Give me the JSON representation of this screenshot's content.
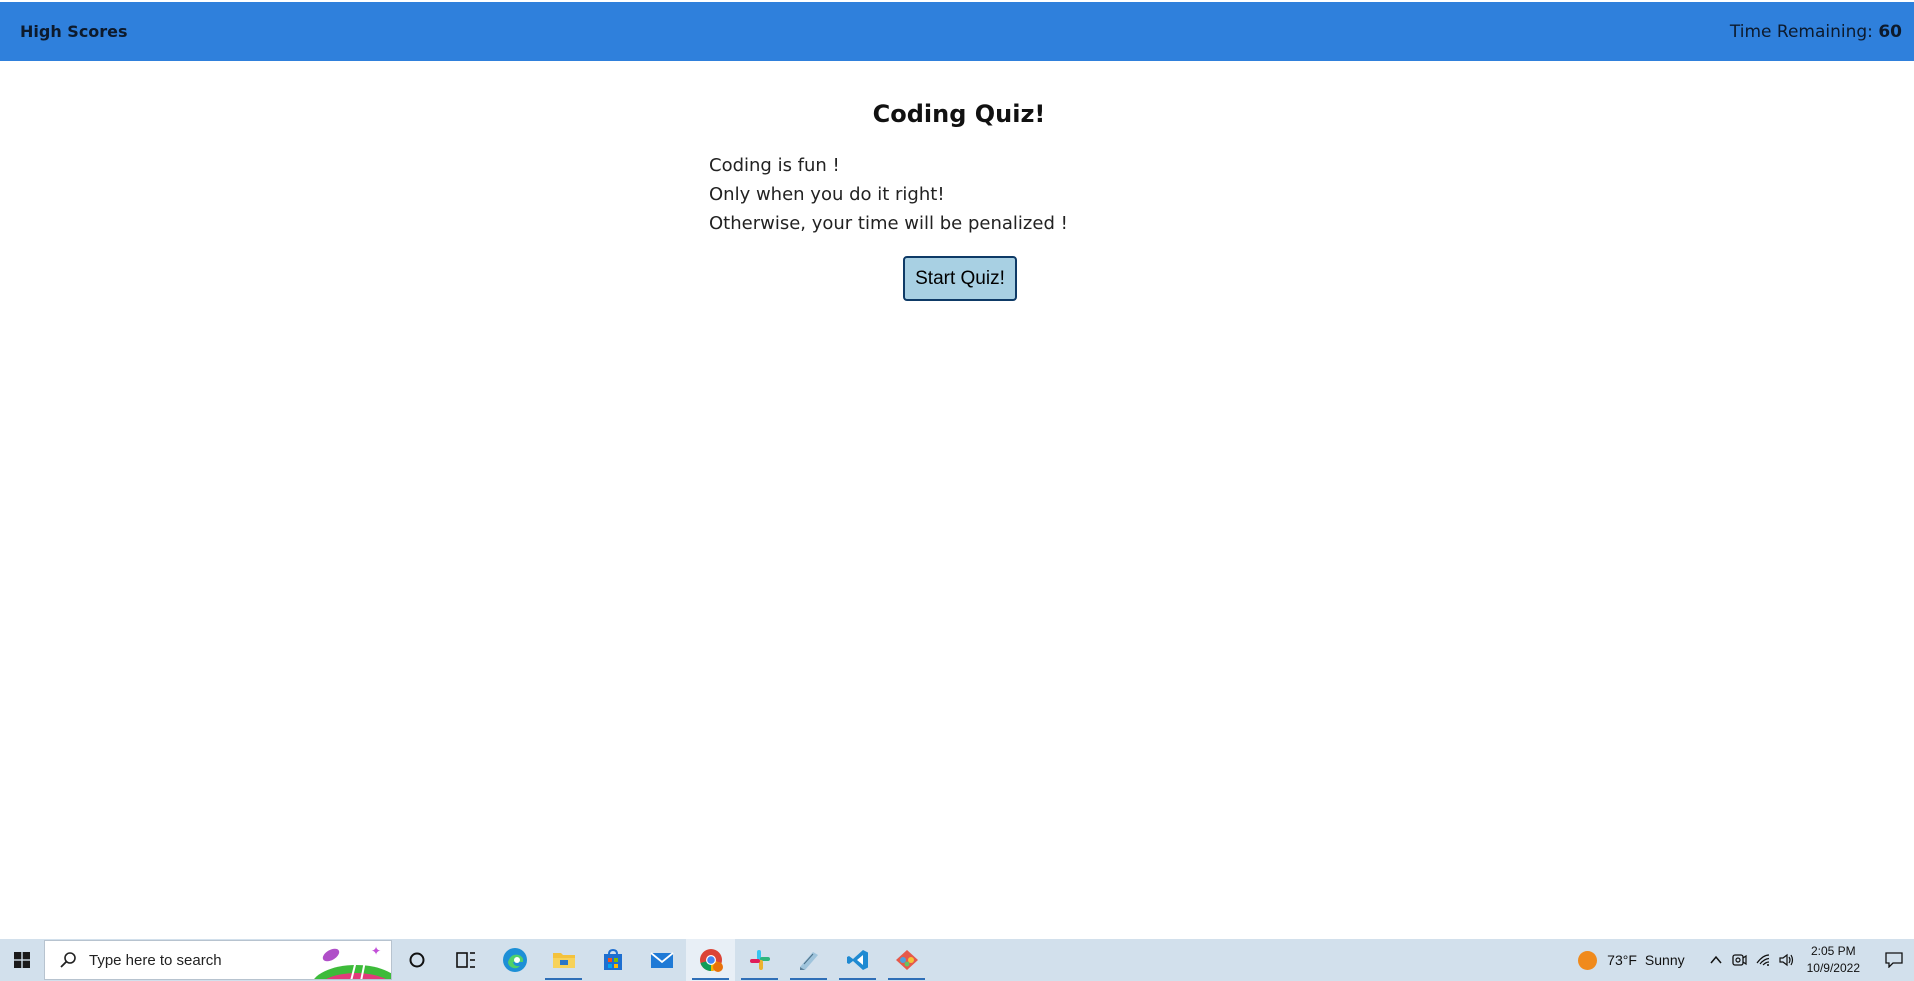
{
  "nav": {
    "high_scores": "High Scores",
    "time_label": "Time Remaining:",
    "time_value": "60"
  },
  "quiz": {
    "title": "Coding Quiz!",
    "lines": [
      "Coding is fun !",
      "Only when you do it right!",
      "Otherwise, your time will be penalized !"
    ],
    "start_button": "Start Quiz!"
  },
  "taskbar": {
    "search_placeholder": "Type here to search",
    "apps": [
      {
        "name": "cortana-icon"
      },
      {
        "name": "task-view-icon"
      },
      {
        "name": "edge-icon"
      },
      {
        "name": "file-explorer-icon",
        "open": true
      },
      {
        "name": "microsoft-store-icon"
      },
      {
        "name": "mail-icon"
      },
      {
        "name": "chrome-icon",
        "open": true,
        "active": true
      },
      {
        "name": "slack-icon",
        "open": true
      },
      {
        "name": "notepad-icon",
        "open": true
      },
      {
        "name": "vscode-icon",
        "open": true
      },
      {
        "name": "git-icon",
        "open": true
      }
    ],
    "weather_temp": "73°F",
    "weather_text": "Sunny",
    "time": "2:05 PM",
    "date": "10/9/2022"
  },
  "colors": {
    "nav_bg": "#2f80dc",
    "button_bg": "#a8d0e3",
    "button_border": "#0e3a66",
    "taskbar_bg": "#d2e0ec"
  }
}
